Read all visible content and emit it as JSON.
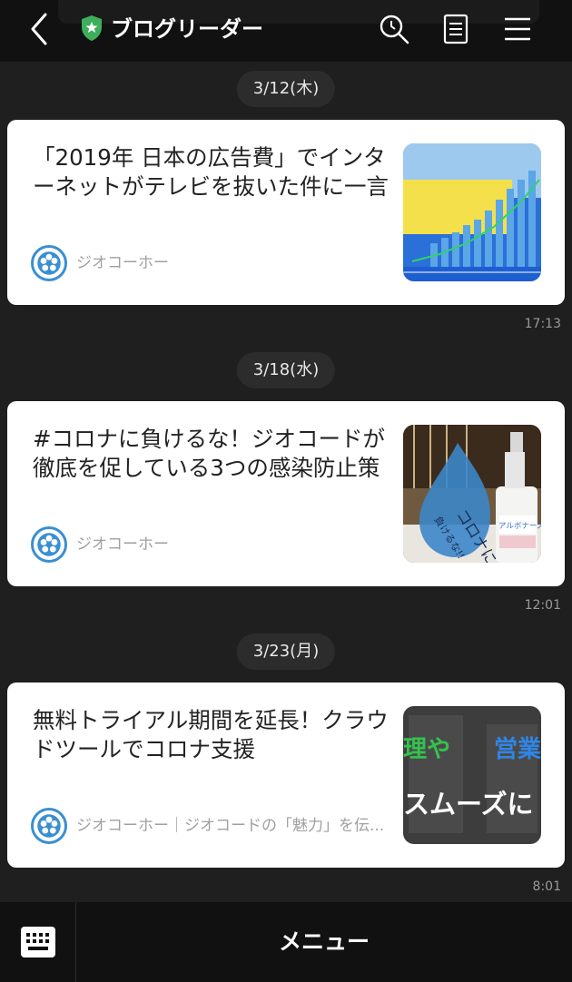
{
  "header": {
    "title": "ブログリーダー",
    "accent_color": "#3fae5a",
    "icons": [
      "back-icon",
      "shield-star-icon",
      "search-icon",
      "note-icon",
      "menu-icon"
    ]
  },
  "feed": {
    "dates": [
      "3/12(木)",
      "3/18(水)",
      "3/23(月)"
    ],
    "cards": [
      {
        "headline": "「2019年 日本の広告費」でインターネットがテレビを抜いた件に一言",
        "source": "ジオコーホー",
        "time": "17:13",
        "thumb": "ad-spend-chart-image"
      },
      {
        "headline": "#コロナに負けるな！ジオコードが徹底を促している3つの感染防止策",
        "source": "ジオコーホー",
        "time": "12:01",
        "thumb": "sanitizer-image",
        "thumb_texts": [
          "コロナに",
          "負けるな!!",
          "アルボナース"
        ]
      },
      {
        "headline": "無料トライアル期間を延長！クラウドツールでコロナ支援",
        "source": "ジオコーホー｜ジオコードの「魅力」を伝...",
        "time": "8:01",
        "thumb": "cloud-tool-image",
        "thumb_texts": [
          "理や",
          "営業",
          "スムーズに"
        ]
      }
    ]
  },
  "footer": {
    "menu_label": "メニュー",
    "keyboard_icon": "keyboard-icon"
  }
}
